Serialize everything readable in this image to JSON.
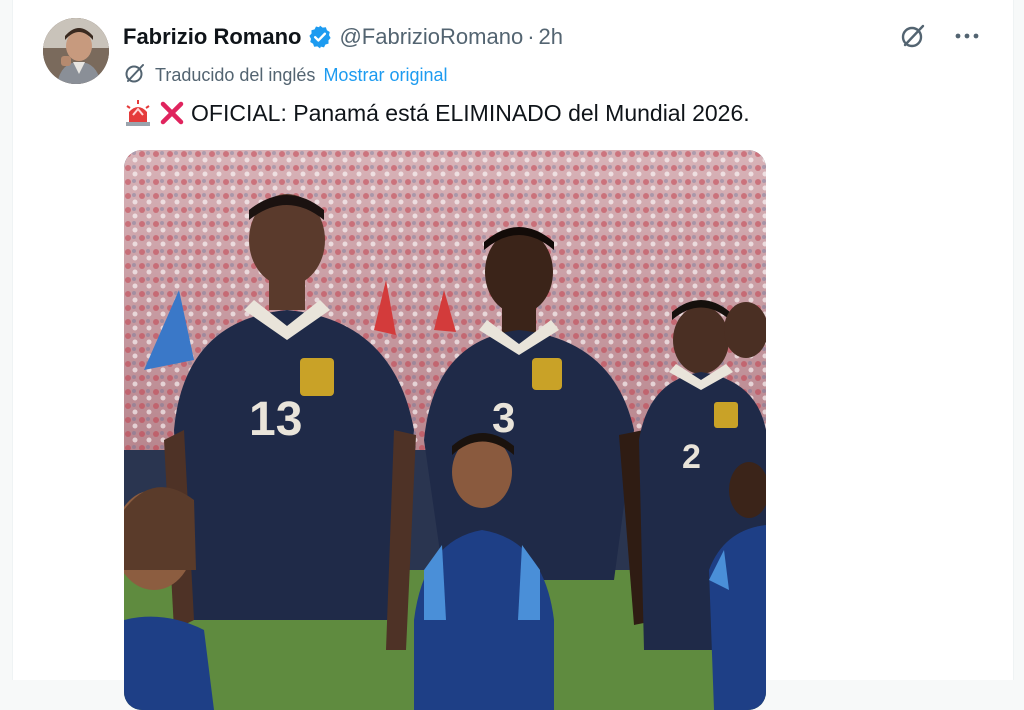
{
  "author": {
    "name": "Fabrizio Romano",
    "handle": "@FabrizioRomano",
    "separator": "·",
    "time": "2h"
  },
  "translation": {
    "label": "Traducido del inglés",
    "action": "Mostrar original"
  },
  "tweet": {
    "text": "OFICIAL: Panamá está ELIMINADO del Mundial 2026."
  },
  "media": {
    "jersey_numbers": [
      "13",
      "3",
      "2"
    ]
  },
  "icons": {
    "verified": "verified-badge-icon",
    "grok": "grok-icon",
    "more": "more-icon",
    "translate": "translate-icon",
    "siren": "siren-emoji",
    "cross": "cross-mark-emoji"
  },
  "colors": {
    "accent": "#1d9bf0",
    "text": "#0f1419",
    "muted": "#536471",
    "cross": "#e0245e"
  }
}
